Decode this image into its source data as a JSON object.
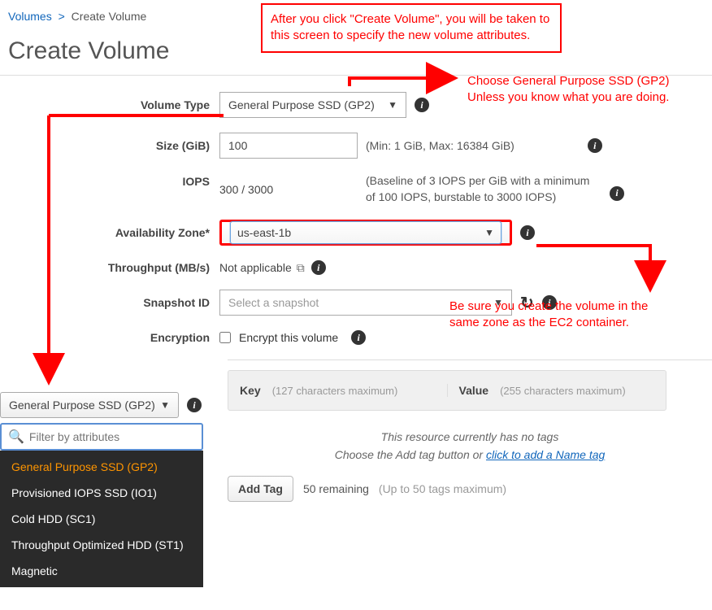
{
  "breadcrumb": {
    "parent": "Volumes",
    "sep": ">",
    "current": "Create Volume"
  },
  "title": "Create Volume",
  "labels": {
    "volumeType": "Volume Type",
    "size": "Size (GiB)",
    "iops": "IOPS",
    "az": "Availability Zone*",
    "throughput": "Throughput (MB/s)",
    "snapshot": "Snapshot ID",
    "encryption": "Encryption"
  },
  "values": {
    "volumeType": "General Purpose SSD (GP2)",
    "size": "100",
    "sizeHint": "(Min: 1 GiB, Max: 16384 GiB)",
    "iops": "300 / 3000",
    "iopsHint": "(Baseline of 3 IOPS per GiB with a minimum of 100 IOPS, burstable to 3000 IOPS)",
    "az": "us-east-1b",
    "throughput": "Not applicable",
    "snapshotPlaceholder": "Select a snapshot",
    "encryptLabel": "Encrypt this volume"
  },
  "popout": {
    "headerValue": "General Purpose SSD (GP2)",
    "filterPlaceholder": "Filter by attributes",
    "options": [
      "General Purpose SSD (GP2)",
      "Provisioned IOPS SSD (IO1)",
      "Cold HDD (SC1)",
      "Throughput Optimized HDD (ST1)",
      "Magnetic"
    ]
  },
  "tags": {
    "keyLabel": "Key",
    "keyMax": "(127 characters maximum)",
    "valueLabel": "Value",
    "valueMax": "(255 characters maximum)",
    "emptyMsg": "This resource currently has no tags",
    "hintPrefix": "Choose the Add tag button or ",
    "hintLink": "click to add a Name tag",
    "addBtn": "Add Tag",
    "remaining": "50 remaining",
    "maxHint": "(Up to 50 tags maximum)"
  },
  "annotations": {
    "box1": "After you click \"Create Volume\", you will be taken to this screen to specify the new volume attributes.",
    "text2a": "Choose General Purpose SSD (GP2)",
    "text2b": "Unless you know what you are doing.",
    "text3a": "Be sure you create the volume in the",
    "text3b": "same zone as the EC2 container."
  },
  "icons": {
    "info": "i",
    "caret": "▼",
    "refresh": "↻",
    "copy": "⧉",
    "search": "🔍"
  }
}
